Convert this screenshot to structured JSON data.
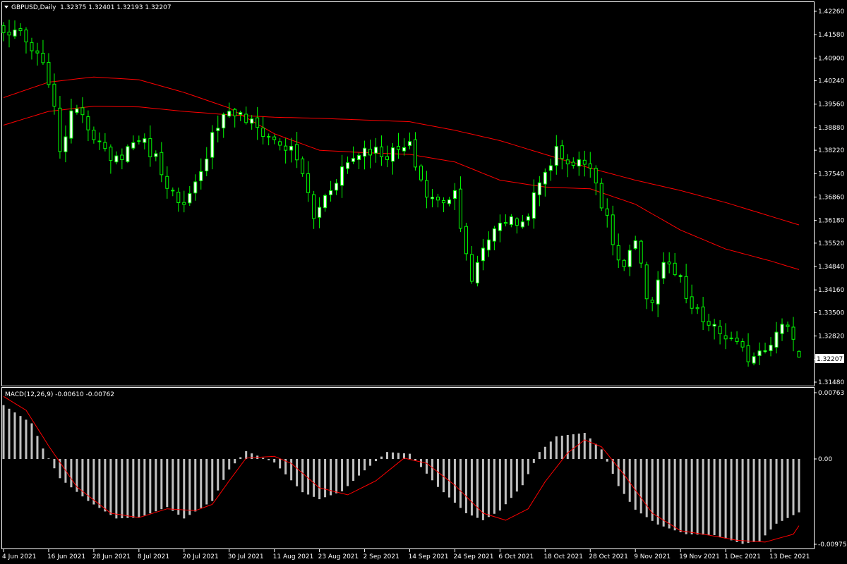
{
  "header": {
    "symbol_line": "GBPUSD,Daily  1.32375 1.32401 1.32193 1.32207",
    "macd_line": "MACD(12,26,9) -0.00610 -0.00762"
  },
  "current_price_label": "1.32207",
  "colors": {
    "background": "#000000",
    "frame": "#ffffff",
    "bull_body": "#ffffff",
    "candle_outline": "#00ff00",
    "moving_average": "#ff0000",
    "macd_histogram": "#c0c0c0",
    "macd_signal": "#ff0000"
  },
  "chart_data": [
    {
      "type": "candlestick",
      "title": "GBPUSD,Daily",
      "ylim": [
        1.3148,
        1.4226
      ],
      "y_ticks": [
        "1.42260",
        "1.41580",
        "1.40900",
        "1.40240",
        "1.39560",
        "1.38880",
        "1.38220",
        "1.37540",
        "1.36860",
        "1.36180",
        "1.35520",
        "1.34840",
        "1.34160",
        "1.33500",
        "1.32820",
        "1.32140",
        "1.31480"
      ],
      "x_ticks": [
        "4 Jun 2021",
        "16 Jun 2021",
        "28 Jun 2021",
        "8 Jul 2021",
        "20 Jul 2021",
        "30 Jul 2021",
        "11 Aug 2021",
        "23 Aug 2021",
        "2 Sep 2021",
        "14 Sep 2021",
        "24 Sep 2021",
        "6 Oct 2021",
        "18 Oct 2021",
        "28 Oct 2021",
        "9 Nov 2021",
        "19 Nov 2021",
        "1 Dec 2021",
        "13 Dec 2021"
      ],
      "close_anchors": [
        [
          "4 Jun 2021",
          1.416
        ],
        [
          "8 Jun 2021",
          1.417
        ],
        [
          "11 Jun 2021",
          1.411
        ],
        [
          "14 Jun 2021",
          1.409
        ],
        [
          "16 Jun 2021",
          1.403
        ],
        [
          "18 Jun 2021",
          1.383
        ],
        [
          "23 Jun 2021",
          1.396
        ],
        [
          "28 Jun 2021",
          1.387
        ],
        [
          "1 Jul 2021",
          1.378
        ],
        [
          "8 Jul 2021",
          1.386
        ],
        [
          "13 Jul 2021",
          1.38
        ],
        [
          "19 Jul 2021",
          1.366
        ],
        [
          "20 Jul 2021",
          1.365
        ],
        [
          "23 Jul 2021",
          1.375
        ],
        [
          "27 Jul 2021",
          1.388
        ],
        [
          "30 Jul 2021",
          1.394
        ],
        [
          "4 Aug 2021",
          1.391
        ],
        [
          "11 Aug 2021",
          1.385
        ],
        [
          "16 Aug 2021",
          1.382
        ],
        [
          "18 Aug 2021",
          1.376
        ],
        [
          "20 Aug 2021",
          1.362
        ],
        [
          "23 Aug 2021",
          1.366
        ],
        [
          "27 Aug 2021",
          1.377
        ],
        [
          "2 Sep 2021",
          1.383
        ],
        [
          "8 Sep 2021",
          1.381
        ],
        [
          "14 Sep 2021",
          1.383
        ],
        [
          "17 Sep 2021",
          1.369
        ],
        [
          "21 Sep 2021",
          1.367
        ],
        [
          "24 Sep 2021",
          1.37
        ],
        [
          "28 Sep 2021",
          1.353
        ],
        [
          "29 Sep 2021",
          1.343
        ],
        [
          "1 Oct 2021",
          1.354
        ],
        [
          "6 Oct 2021",
          1.362
        ],
        [
          "12 Oct 2021",
          1.361
        ],
        [
          "15 Oct 2021",
          1.372
        ],
        [
          "18 Oct 2021",
          1.376
        ],
        [
          "20 Oct 2021",
          1.382
        ],
        [
          "25 Oct 2021",
          1.378
        ],
        [
          "28 Oct 2021",
          1.379
        ],
        [
          "1 Nov 2021",
          1.367
        ],
        [
          "4 Nov 2021",
          1.35
        ],
        [
          "5 Nov 2021",
          1.348
        ],
        [
          "9 Nov 2021",
          1.355
        ],
        [
          "11 Nov 2021",
          1.34
        ],
        [
          "12 Nov 2021",
          1.339
        ],
        [
          "16 Nov 2021",
          1.35
        ],
        [
          "19 Nov 2021",
          1.344
        ],
        [
          "22 Nov 2021",
          1.338
        ],
        [
          "26 Nov 2021",
          1.331
        ],
        [
          "1 Dec 2021",
          1.328
        ],
        [
          "7 Dec 2021",
          1.322
        ],
        [
          "13 Dec 2021",
          1.327
        ],
        [
          "16 Dec 2021",
          1.332
        ],
        [
          "20 Dec 2021",
          1.32207
        ]
      ],
      "last_candle": {
        "open": 1.32375,
        "high": 1.32401,
        "low": 1.32193,
        "close": 1.32207
      },
      "moving_averages": [
        {
          "anchors": [
            [
              "4 Jun 2021",
              1.3975
            ],
            [
              "16 Jun 2021",
              1.402
            ],
            [
              "28 Jun 2021",
              1.4035
            ],
            [
              "8 Jul 2021",
              1.4027
            ],
            [
              "20 Jul 2021",
              1.399
            ],
            [
              "30 Jul 2021",
              1.3945
            ],
            [
              "11 Aug 2021",
              1.387
            ],
            [
              "23 Aug 2021",
              1.3822
            ],
            [
              "2 Sep 2021",
              1.3815
            ],
            [
              "14 Sep 2021",
              1.381
            ],
            [
              "24 Sep 2021",
              1.3788
            ],
            [
              "6 Oct 2021",
              1.3735
            ],
            [
              "18 Oct 2021",
              1.3715
            ],
            [
              "28 Oct 2021",
              1.371
            ],
            [
              "9 Nov 2021",
              1.3665
            ],
            [
              "19 Nov 2021",
              1.359
            ],
            [
              "1 Dec 2021",
              1.3535
            ],
            [
              "13 Dec 2021",
              1.35
            ],
            [
              "20 Dec 2021",
              1.3475
            ]
          ]
        },
        {
          "anchors": [
            [
              "4 Jun 2021",
              1.3895
            ],
            [
              "16 Jun 2021",
              1.3935
            ],
            [
              "28 Jun 2021",
              1.395
            ],
            [
              "8 Jul 2021",
              1.3948
            ],
            [
              "20 Jul 2021",
              1.3935
            ],
            [
              "30 Jul 2021",
              1.3925
            ],
            [
              "11 Aug 2021",
              1.3918
            ],
            [
              "23 Aug 2021",
              1.3915
            ],
            [
              "2 Sep 2021",
              1.391
            ],
            [
              "14 Sep 2021",
              1.3905
            ],
            [
              "24 Sep 2021",
              1.388
            ],
            [
              "6 Oct 2021",
              1.385
            ],
            [
              "18 Oct 2021",
              1.381
            ],
            [
              "28 Oct 2021",
              1.377
            ],
            [
              "9 Nov 2021",
              1.3735
            ],
            [
              "19 Nov 2021",
              1.3705
            ],
            [
              "1 Dec 2021",
              1.367
            ],
            [
              "13 Dec 2021",
              1.363
            ],
            [
              "20 Dec 2021",
              1.3605
            ]
          ]
        }
      ]
    },
    {
      "type": "bar",
      "title": "MACD(12,26,9)",
      "ylim": [
        -0.00975,
        0.00763
      ],
      "y_ticks": [
        "0.00763",
        "0.00",
        "-0.00975"
      ],
      "last_main": -0.0061,
      "last_signal": -0.00762,
      "histogram_anchors": [
        [
          "4 Jun 2021",
          0.0062
        ],
        [
          "11 Jun 2021",
          0.0041
        ],
        [
          "15 Jun 2021",
          0.0012
        ],
        [
          "18 Jun 2021",
          -0.0022
        ],
        [
          "25 Jun 2021",
          -0.0048
        ],
        [
          "2 Jul 2021",
          -0.0068
        ],
        [
          "8 Jul 2021",
          -0.0067
        ],
        [
          "15 Jul 2021",
          -0.0055
        ],
        [
          "20 Jul 2021",
          -0.0068
        ],
        [
          "27 Jul 2021",
          -0.0048
        ],
        [
          "30 Jul 2021",
          -0.0012
        ],
        [
          "4 Aug 2021",
          0.0009
        ],
        [
          "11 Aug 2021",
          -0.0004
        ],
        [
          "18 Aug 2021",
          -0.0038
        ],
        [
          "23 Aug 2021",
          -0.0046
        ],
        [
          "27 Aug 2021",
          -0.0037
        ],
        [
          "2 Sep 2021",
          -0.0013
        ],
        [
          "8 Sep 2021",
          0.0008
        ],
        [
          "14 Sep 2021",
          0.0006
        ],
        [
          "21 Sep 2021",
          -0.0032
        ],
        [
          "28 Sep 2021",
          -0.0062
        ],
        [
          "1 Oct 2021",
          -0.007
        ],
        [
          "6 Oct 2021",
          -0.0059
        ],
        [
          "12 Oct 2021",
          -0.003
        ],
        [
          "15 Oct 2021",
          0.0008
        ],
        [
          "20 Oct 2021",
          0.0026
        ],
        [
          "27 Oct 2021",
          0.003
        ],
        [
          "1 Nov 2021",
          0.0011
        ],
        [
          "4 Nov 2021",
          -0.0031
        ],
        [
          "9 Nov 2021",
          -0.0058
        ],
        [
          "15 Nov 2021",
          -0.0075
        ],
        [
          "22 Nov 2021",
          -0.0086
        ],
        [
          "29 Nov 2021",
          -0.0087
        ],
        [
          "6 Dec 2021",
          -0.0097
        ],
        [
          "9 Dec 2021",
          -0.0094
        ],
        [
          "14 Dec 2021",
          -0.0074
        ],
        [
          "20 Dec 2021",
          -0.0061
        ]
      ],
      "signal_anchors": [
        [
          "4 Jun 2021",
          0.0072
        ],
        [
          "10 Jun 2021",
          0.0056
        ],
        [
          "16 Jun 2021",
          0.0015
        ],
        [
          "23 Jun 2021",
          -0.0032
        ],
        [
          "1 Jul 2021",
          -0.0062
        ],
        [
          "8 Jul 2021",
          -0.0067
        ],
        [
          "15 Jul 2021",
          -0.0057
        ],
        [
          "22 Jul 2021",
          -0.0059
        ],
        [
          "27 Jul 2021",
          -0.0052
        ],
        [
          "30 Jul 2021",
          -0.0025
        ],
        [
          "4 Aug 2021",
          0.0001
        ],
        [
          "11 Aug 2021",
          0.0003
        ],
        [
          "16 Aug 2021",
          -0.0005
        ],
        [
          "23 Aug 2021",
          -0.0033
        ],
        [
          "30 Aug 2021",
          -0.0041
        ],
        [
          "6 Sep 2021",
          -0.0025
        ],
        [
          "13 Sep 2021",
          0.0001
        ],
        [
          "17 Sep 2021",
          -0.0005
        ],
        [
          "24 Sep 2021",
          -0.003
        ],
        [
          "1 Oct 2021",
          -0.0062
        ],
        [
          "7 Oct 2021",
          -0.007
        ],
        [
          "13 Oct 2021",
          -0.0057
        ],
        [
          "18 Oct 2021",
          -0.0026
        ],
        [
          "22 Oct 2021",
          0.0007
        ],
        [
          "27 Oct 2021",
          0.0022
        ],
        [
          "1 Nov 2021",
          0.0014
        ],
        [
          "5 Nov 2021",
          -0.0018
        ],
        [
          "12 Nov 2021",
          -0.0062
        ],
        [
          "19 Nov 2021",
          -0.0082
        ],
        [
          "26 Nov 2021",
          -0.0087
        ],
        [
          "3 Dec 2021",
          -0.0093
        ],
        [
          "10 Dec 2021",
          -0.0095
        ],
        [
          "17 Dec 2021",
          -0.0086
        ],
        [
          "20 Dec 2021",
          -0.0076
        ]
      ]
    }
  ]
}
